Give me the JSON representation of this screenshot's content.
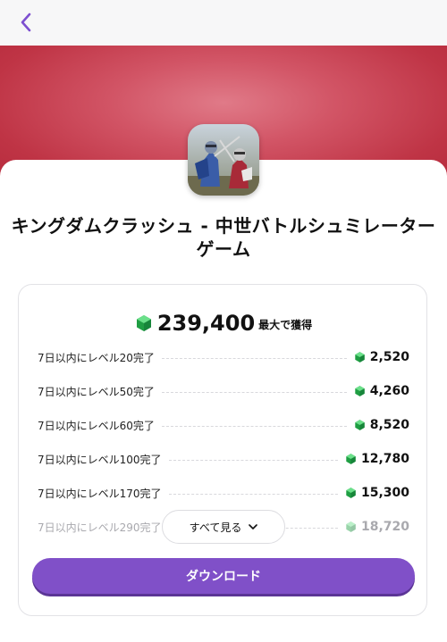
{
  "header": {
    "back_icon": "chevron-left-icon"
  },
  "app": {
    "icon": "knight-battle-app-icon",
    "title_line1": "キングダムクラッシュ - 中世バトルシュミレーター",
    "title_line2": "ゲーム"
  },
  "rewards": {
    "total_value": "239,400",
    "total_suffix": "最大で獲得",
    "tasks": [
      {
        "label": "7日以内にレベル20完了",
        "reward": "2,520"
      },
      {
        "label": "7日以内にレベル50完了",
        "reward": "4,260"
      },
      {
        "label": "7日以内にレベル60完了",
        "reward": "8,520"
      },
      {
        "label": "7日以内にレベル100完了",
        "reward": "12,780"
      },
      {
        "label": "7日以内にレベル170完了",
        "reward": "15,300"
      },
      {
        "label": "7日以内にレベル290完了",
        "reward": "18,720"
      }
    ],
    "see_all_label": "すべて見る"
  },
  "download_label": "ダウンロード",
  "colors": {
    "accent": "#8050c8",
    "hero": "#c83c50",
    "gem": "#22b14c"
  }
}
